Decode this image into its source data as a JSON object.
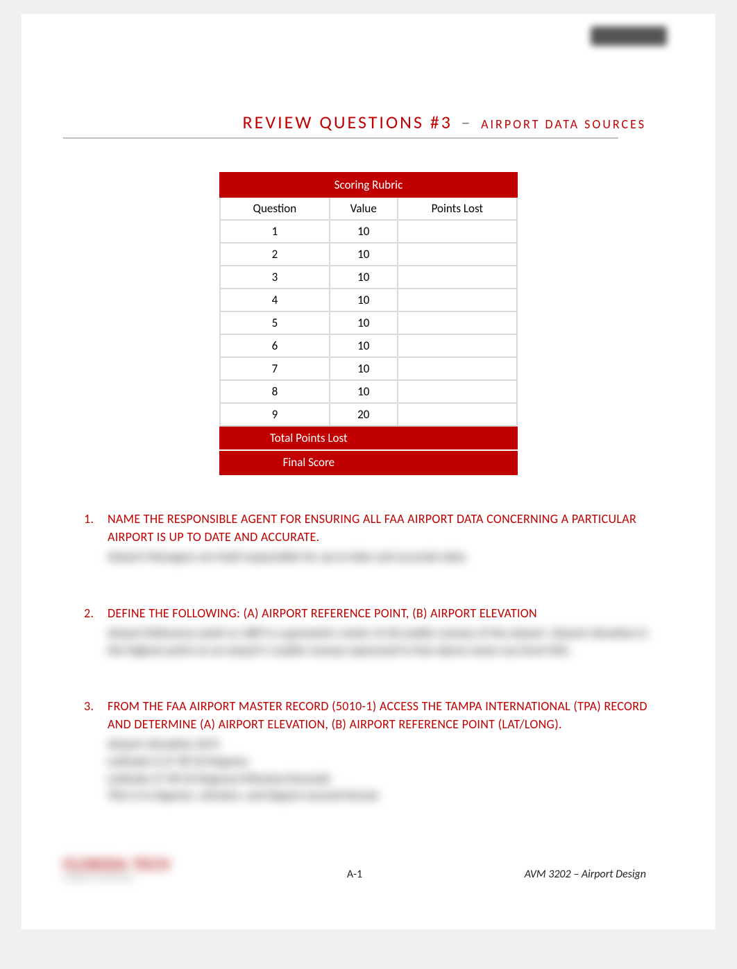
{
  "title": {
    "main": "REVIEW QUESTIONS #3",
    "separator": "–",
    "subtitle": "AIRPORT DATA SOURCES"
  },
  "rubric": {
    "header": "Scoring Rubric",
    "col_question": "Question",
    "col_value": "Value",
    "col_points_lost": "Points Lost",
    "rows": [
      {
        "q": "1",
        "v": "10",
        "pl": ""
      },
      {
        "q": "2",
        "v": "10",
        "pl": ""
      },
      {
        "q": "3",
        "v": "10",
        "pl": ""
      },
      {
        "q": "4",
        "v": "10",
        "pl": ""
      },
      {
        "q": "5",
        "v": "10",
        "pl": ""
      },
      {
        "q": "6",
        "v": "10",
        "pl": ""
      },
      {
        "q": "7",
        "v": "10",
        "pl": ""
      },
      {
        "q": "8",
        "v": "10",
        "pl": ""
      },
      {
        "q": "9",
        "v": "20",
        "pl": ""
      }
    ],
    "total_label": "Total Points Lost",
    "final_label": "Final Score"
  },
  "questions": [
    {
      "num": "1.",
      "text": "NAME THE RESPONSIBLE AGENT FOR ENSURING ALL FAA AIRPORT DATA CONCERNING A PARTICULAR AIRPORT IS UP TO DATE AND ACCURATE.",
      "answer": "Airport Managers are held responsible for up to date and accurate data."
    },
    {
      "num": "2.",
      "text": "DEFINE THE FOLLOWING: (A) AIRPORT REFERENCE POINT, (B) AIRPORT ELEVATION",
      "answer": "Airport Reference point or ARP is a geometric center of all usable runway of the airport. Airport elevation is the highest point on an airport's usable runway expressed in feet above mean sea level MSL."
    },
    {
      "num": "3.",
      "text": "FROM THE FAA AIRPORT MASTER RECORD (5010-1) ACCESS THE TAMPA INTERNATIONAL (TPA) RECORD AND DETERMINE (A) AIRPORT ELEVATION, (B) AIRPORT REFERENCE POINT (LAT/LONG).",
      "answer": "Airport elevation 26 ft\nLatitude    N 27 58 32    Degrees\nLatitude    27 58 32    Degrees/Minutes/Seconds\nThis is in degrees, minutes, and degree-second format"
    }
  ],
  "footer": {
    "page_num": "A-1",
    "course": "AVM 3202 – Airport Design"
  }
}
